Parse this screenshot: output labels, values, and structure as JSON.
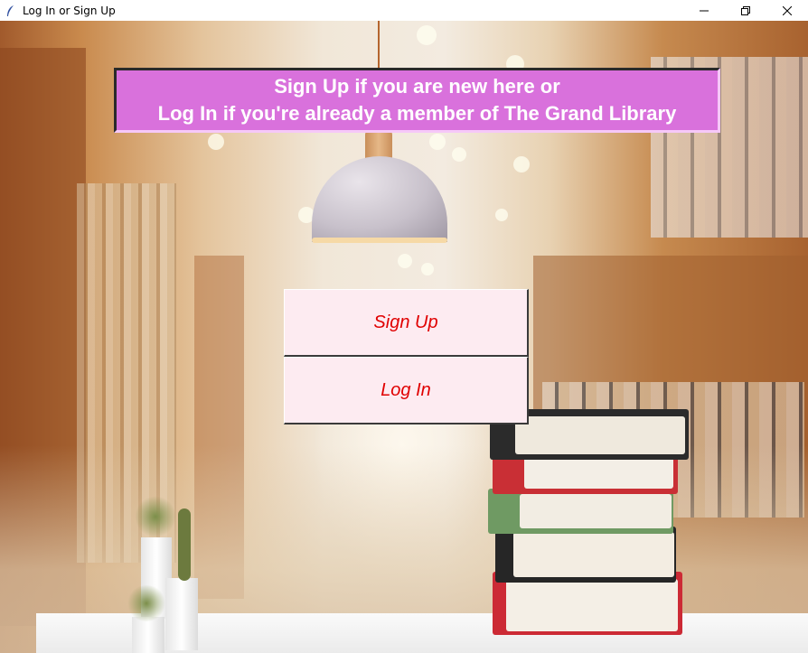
{
  "window": {
    "title": "Log In or Sign Up",
    "controls": [
      "minimize",
      "restore",
      "close"
    ]
  },
  "banner": {
    "line1": "Sign Up if you are new here or",
    "line2": "Log In if you're already a member of The Grand Library"
  },
  "buttons": {
    "signup_label": "Sign Up",
    "login_label": "Log In"
  },
  "colors": {
    "banner_bg": "#d971dc",
    "button_bg": "#fdebf1",
    "button_text": "#e00000"
  }
}
